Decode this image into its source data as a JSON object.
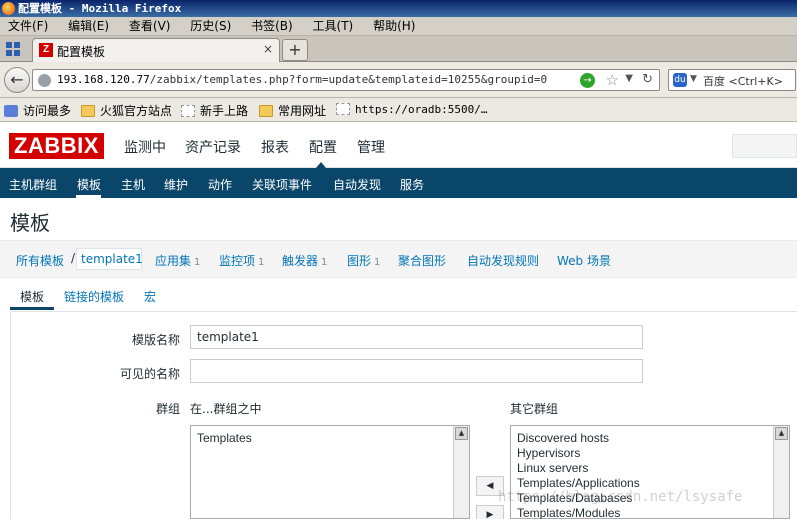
{
  "window": {
    "title": "配置模板 - Mozilla Firefox"
  },
  "menubar": [
    "文件(F)",
    "编辑(E)",
    "查看(V)",
    "历史(S)",
    "书签(B)",
    "工具(T)",
    "帮助(H)"
  ],
  "tab": {
    "icon_letter": "Z",
    "label": "配置模板",
    "close": "×",
    "new_tab": "+"
  },
  "nav": {
    "url_prefix": "193.168.120.77",
    "url_rest": "/zabbix/templates.php?form=update&templateid=10255&groupid=0",
    "search_placeholder": "百度 <Ctrl+K>"
  },
  "bookmarks": [
    "访问最多",
    "火狐官方站点",
    "新手上路",
    "常用网址",
    "https://oradb:5500/…"
  ],
  "zabbix": {
    "logo": "ZABBIX",
    "topnav": [
      "监测中",
      "资产记录",
      "报表",
      "配置",
      "管理"
    ],
    "subnav": [
      "主机群组",
      "模板",
      "主机",
      "维护",
      "动作",
      "关联项事件",
      "自动发现",
      "服务"
    ],
    "page_title": "模板",
    "breadcrumbs": {
      "all_templates": "所有模板",
      "sep": "/",
      "current": "template1",
      "items": [
        {
          "label": "应用集",
          "count": "1"
        },
        {
          "label": "监控项",
          "count": "1"
        },
        {
          "label": "触发器",
          "count": "1"
        },
        {
          "label": "图形",
          "count": "1"
        },
        {
          "label": "聚合图形",
          "count": ""
        },
        {
          "label": "自动发现规则",
          "count": ""
        },
        {
          "label": "Web 场景",
          "count": ""
        }
      ]
    },
    "form_tabs": [
      "模板",
      "链接的模板",
      "宏"
    ],
    "form": {
      "template_name_label": "模版名称",
      "template_name_value": "template1",
      "visible_name_label": "可见的名称",
      "visible_name_value": "",
      "groups_label": "群组",
      "in_groups_label": "在...群组之中",
      "other_groups_label": "其它群组",
      "in_groups": [
        "Templates"
      ],
      "other_groups": [
        "Discovered hosts",
        "Hypervisors",
        "Linux servers",
        "Templates/Applications",
        "Templates/Databases",
        "Templates/Modules"
      ],
      "move_left": "◀",
      "move_right": "▶"
    }
  },
  "watermark": "https://blog.csdn.net/lsysafe"
}
